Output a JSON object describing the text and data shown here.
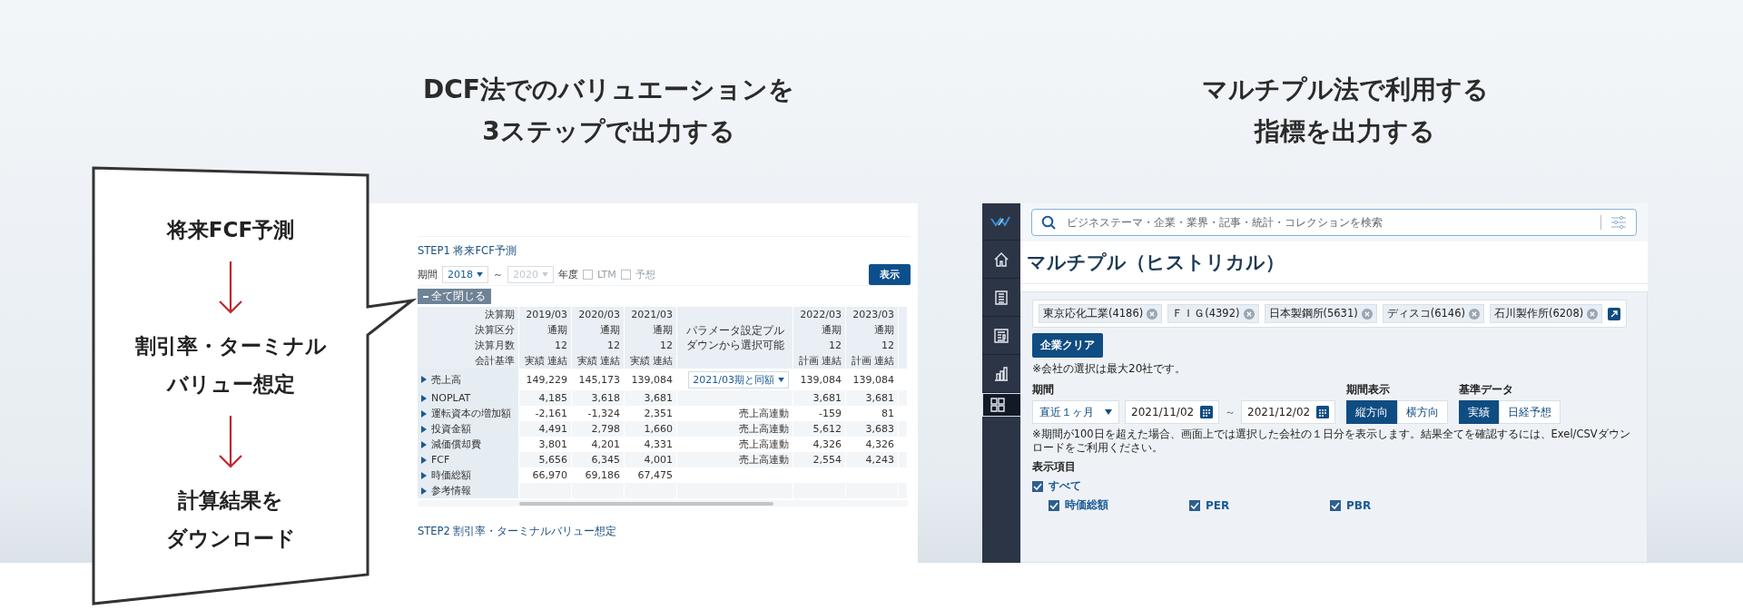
{
  "headings": [
    {
      "lines": [
        "DCF法でのバリュエーションを",
        "3ステップで出力する"
      ]
    },
    {
      "lines": [
        "マルチプル法で利用する",
        "指標を出力する"
      ]
    }
  ],
  "callout": {
    "steps": [
      {
        "lines": [
          "将来FCF予測"
        ]
      },
      {
        "lines": [
          "割引率・ターミナル",
          "バリュー想定"
        ]
      },
      {
        "lines": [
          "計算結果を",
          "ダウンロード"
        ]
      }
    ]
  },
  "dcf_screen": {
    "step1_title": "STEP1 将来FCF予測",
    "period_label": "期間",
    "start_year": {
      "value": "2018",
      "disabled": false
    },
    "separator": "～",
    "end_year": {
      "value": "2020",
      "disabled": true
    },
    "year_unit": "年度",
    "options": [
      {
        "label": "LTM",
        "checked": false
      },
      {
        "label": "予想",
        "checked": false
      }
    ],
    "show_button": "表示",
    "collapse_button": "全て閉じる",
    "header_rows": [
      {
        "label": "決算期",
        "cells": [
          "2019/03",
          "2020/03",
          "2021/03",
          "2022/03",
          "2023/03"
        ]
      },
      {
        "label": "決算区分",
        "cells": [
          "通期",
          "通期",
          "通期",
          "通期",
          "通期"
        ]
      },
      {
        "label": "決算月数",
        "cells": [
          "12",
          "12",
          "12",
          "12",
          "12"
        ]
      },
      {
        "label": "会計基準",
        "cells": [
          "実績 連結",
          "実績 連結",
          "実績 連結",
          "計画 連結",
          "計画 連結"
        ]
      }
    ],
    "param_note": "パラメータ設定プルダウンから選択可能",
    "rows": [
      {
        "label": "売上高",
        "values": [
          "149,229",
          "145,173",
          "139,084",
          "139,084",
          "139,084"
        ],
        "param": {
          "kind": "dropdown",
          "text": "2021/03期と同額"
        }
      },
      {
        "label": "NOPLAT",
        "values": [
          "4,185",
          "3,618",
          "3,681",
          "3,681",
          "3,681"
        ]
      },
      {
        "label": "運転資本の増加額",
        "values": [
          "-2,161",
          "-1,324",
          "2,351",
          "-159",
          "81"
        ],
        "param": {
          "kind": "text",
          "text": "売上高連動"
        }
      },
      {
        "label": "投資金額",
        "values": [
          "4,491",
          "2,798",
          "1,660",
          "5,612",
          "3,683"
        ],
        "param": {
          "kind": "text",
          "text": "売上高連動"
        }
      },
      {
        "label": "減価償却費",
        "values": [
          "3,801",
          "4,201",
          "4,331",
          "4,326",
          "4,326"
        ],
        "param": {
          "kind": "text",
          "text": "売上高連動"
        }
      },
      {
        "label": "FCF",
        "values": [
          "5,656",
          "6,345",
          "4,001",
          "2,554",
          "4,243"
        ],
        "param": {
          "kind": "text",
          "text": "売上高連動"
        }
      },
      {
        "label": "時価総額",
        "values": [
          "66,970",
          "69,186",
          "67,475"
        ]
      },
      {
        "label": "参考情報"
      }
    ],
    "step2_title": "STEP2 割引率・ターミナルバリュー想定"
  },
  "multiple_screen": {
    "nav": [
      {
        "kind": "home",
        "selected": false
      },
      {
        "kind": "document",
        "selected": false
      },
      {
        "kind": "news",
        "selected": false
      },
      {
        "kind": "chart",
        "selected": false
      },
      {
        "kind": "grid",
        "selected": true
      }
    ],
    "search": {
      "placeholder": "ビジネステーマ・企業・業界・記事・統計・コレクションを検索"
    },
    "title": "マルチプル（ヒストリカル）",
    "companies": [
      "東京応化工業(4186)",
      "ＦＩＧ(4392)",
      "日本製鋼所(5631)",
      "ディスコ(6146)",
      "石川製作所(6208)"
    ],
    "clear_button": "企業クリア",
    "company_note": "※会社の選択は最大20社です。",
    "period": {
      "label": "期間",
      "preset": "直近１ヶ月",
      "from": "2021/11/02",
      "separator": "～",
      "to": "2021/12/02"
    },
    "orientation": {
      "label": "期間表示",
      "options": [
        {
          "label": "縦方向",
          "selected": true
        },
        {
          "label": "横方向",
          "selected": false
        }
      ]
    },
    "basis": {
      "label": "基準データ",
      "options": [
        {
          "label": "実績",
          "selected": true
        },
        {
          "label": "日経予想",
          "selected": false
        }
      ]
    },
    "period_note": "※期間が100日を超えた場合、画面上では選択した会社の１日分を表示します。結果全てを確認するには、Exel/CSVダウンロードをご利用ください。",
    "display_items": {
      "label": "表示項目",
      "all": {
        "label": "すべて",
        "checked": true
      },
      "items": [
        {
          "label": "時価総額",
          "checked": true
        },
        {
          "label": "PER",
          "checked": true
        },
        {
          "label": "PBR",
          "checked": true
        }
      ]
    }
  }
}
